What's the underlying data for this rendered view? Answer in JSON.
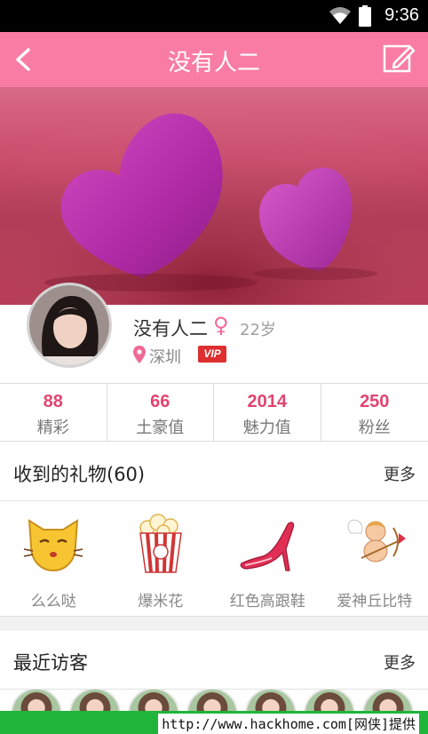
{
  "status_bar": {
    "time": "9:36"
  },
  "app_bar": {
    "title": "没有人二"
  },
  "profile": {
    "name": "没有人二",
    "gender_symbol": "♀",
    "age": "22岁",
    "city": "深圳",
    "badge": "VIP"
  },
  "stats": [
    {
      "value": "88",
      "label": "精彩"
    },
    {
      "value": "66",
      "label": "土豪值"
    },
    {
      "value": "2014",
      "label": "魅力值"
    },
    {
      "value": "250",
      "label": "粉丝"
    }
  ],
  "gifts_section": {
    "title": "收到的礼物(60)",
    "more": "更多",
    "items": [
      {
        "name": "么么哒",
        "icon": "cat-kiss-icon"
      },
      {
        "name": "爆米花",
        "icon": "popcorn-icon"
      },
      {
        "name": "红色高跟鞋",
        "icon": "high-heel-icon"
      },
      {
        "name": "爱神丘比特",
        "icon": "cupid-icon"
      }
    ]
  },
  "visitors_section": {
    "title": "最近访客",
    "more": "更多"
  },
  "watermark": "http://www.hackhome.com[网侠]提供",
  "colors": {
    "accent_pink": "#f97ca4",
    "stat_number": "#e2446f",
    "vip_red": "#dd2f2f"
  }
}
